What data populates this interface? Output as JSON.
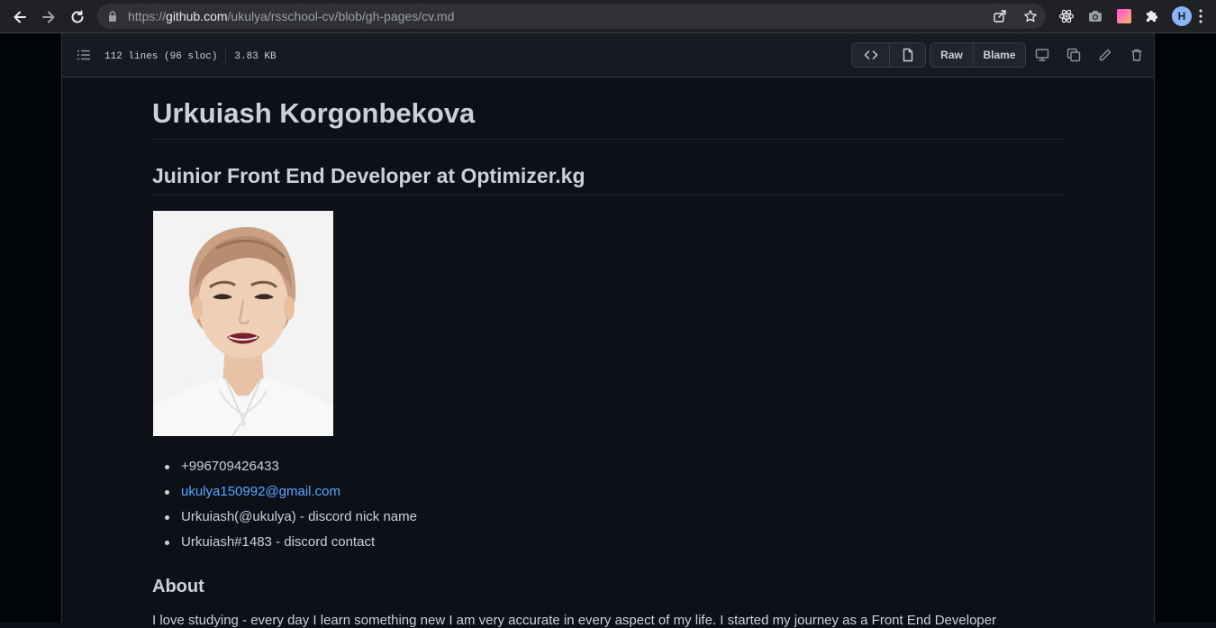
{
  "browser": {
    "url_scheme": "https://",
    "url_host": "github.com",
    "url_path": "/ukulya/rsschool-cv/blob/gh-pages/cv.md",
    "profile_initial": "H"
  },
  "file_header": {
    "lines_info": "112 lines (96 sloc)",
    "size": "3.83 KB",
    "raw_label": "Raw",
    "blame_label": "Blame",
    "icons": [
      "code-icon",
      "file-icon",
      "desktop-icon",
      "copy-icon",
      "pencil-icon",
      "trash-icon"
    ]
  },
  "readme": {
    "name": "Urkuiash Korgonbekova",
    "role": "Juinior Front End Developer at Optimizer.kg",
    "contacts": {
      "phone": "+996709426433",
      "email": "ukulya150992@gmail.com",
      "discord_nick": "Urkuiash(@ukulya) - discord nick name",
      "discord_contact": "Urkuiash#1483 - discord contact"
    },
    "about_heading": "About",
    "about_text": "I love studying - every day I learn something new I am very accurate in every aspect of my life. I started my journey as a Front End Developer"
  },
  "colors": {
    "page_bg": "#0d1117",
    "header_bg": "#161b22",
    "link": "#58a6ff",
    "text": "#c9d1d9"
  }
}
